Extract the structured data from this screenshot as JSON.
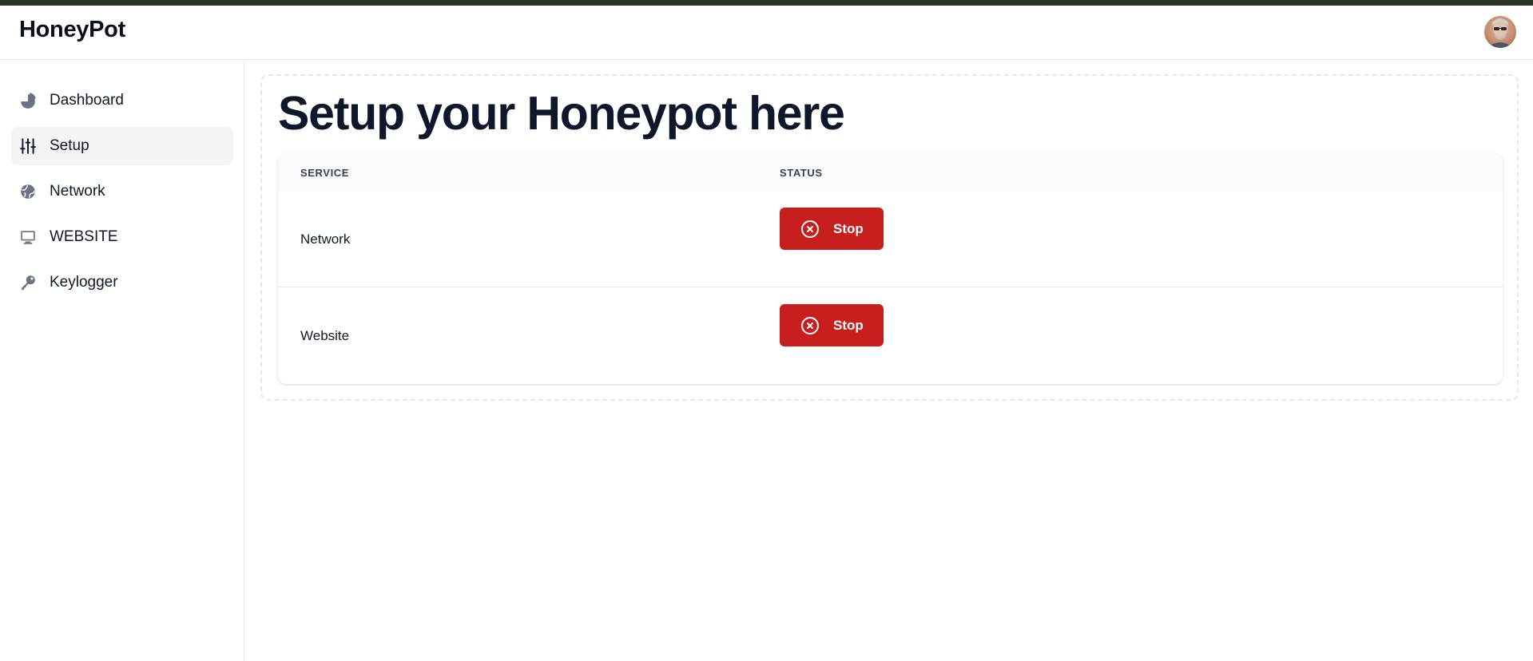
{
  "app": {
    "title": "HoneyPot"
  },
  "header": {
    "avatar_icon": "user-avatar"
  },
  "sidebar": {
    "items": [
      {
        "label": "Dashboard",
        "icon": "pie-chart-icon"
      },
      {
        "label": "Setup",
        "icon": "adjustments-icon",
        "active": true
      },
      {
        "label": "Network",
        "icon": "globe-icon"
      },
      {
        "label": "WEBSITE",
        "icon": "monitor-icon"
      },
      {
        "label": "Keylogger",
        "icon": "key-icon"
      }
    ]
  },
  "main": {
    "title": "Setup your Honeypot here",
    "table": {
      "headers": [
        "SERVICE",
        "STATUS"
      ],
      "rows": [
        {
          "service": "Network",
          "action_label": "Stop",
          "action_icon": "x-circle-icon"
        },
        {
          "service": "Website",
          "action_label": "Stop",
          "action_icon": "x-circle-icon"
        }
      ]
    }
  },
  "colors": {
    "accent_danger": "#c81e1e",
    "top_strip": "#2f3526",
    "active_nav_bg": "#f3f4f6"
  }
}
